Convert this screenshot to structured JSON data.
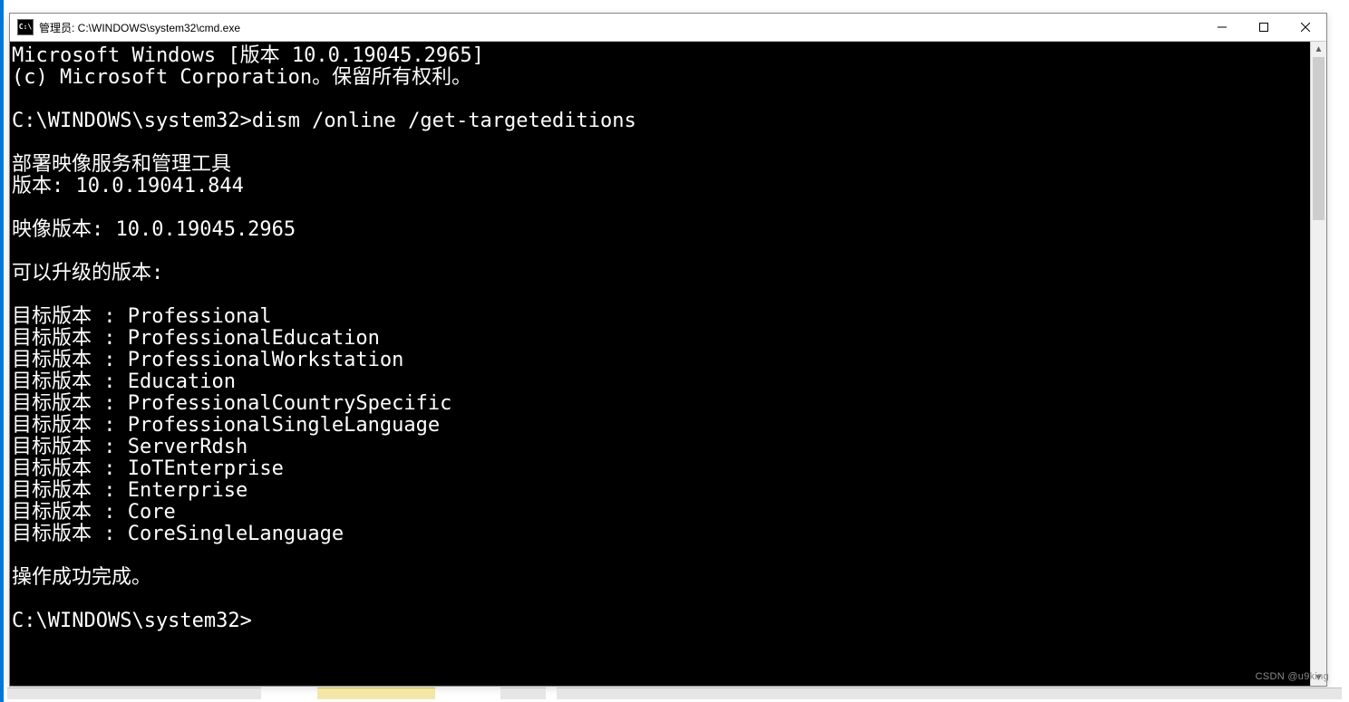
{
  "window": {
    "title": "管理员: C:\\WINDOWS\\system32\\cmd.exe",
    "icon_label": "C:\\"
  },
  "titlebar_controls": {
    "minimize": "minimize-icon",
    "maximize": "maximize-icon",
    "close": "close-icon"
  },
  "console": {
    "header_lines": [
      "Microsoft Windows [版本 10.0.19045.2965]",
      "(c) Microsoft Corporation。保留所有权利。"
    ],
    "prompt1": "C:\\WINDOWS\\system32>",
    "command1": "dism /online /get-targeteditions",
    "tool_lines": [
      "部署映像服务和管理工具",
      "版本: 10.0.19041.844"
    ],
    "image_version_line": "映像版本: 10.0.19045.2965",
    "upgradeable_header": "可以升级的版本:",
    "target_label": "目标版本",
    "targets": [
      "Professional",
      "ProfessionalEducation",
      "ProfessionalWorkstation",
      "Education",
      "ProfessionalCountrySpecific",
      "ProfessionalSingleLanguage",
      "ServerRdsh",
      "IoTEnterprise",
      "Enterprise",
      "Core",
      "CoreSingleLanguage"
    ],
    "success_line": "操作成功完成。",
    "prompt2": "C:\\WINDOWS\\system32>"
  },
  "watermark": "CSDN @u9king"
}
